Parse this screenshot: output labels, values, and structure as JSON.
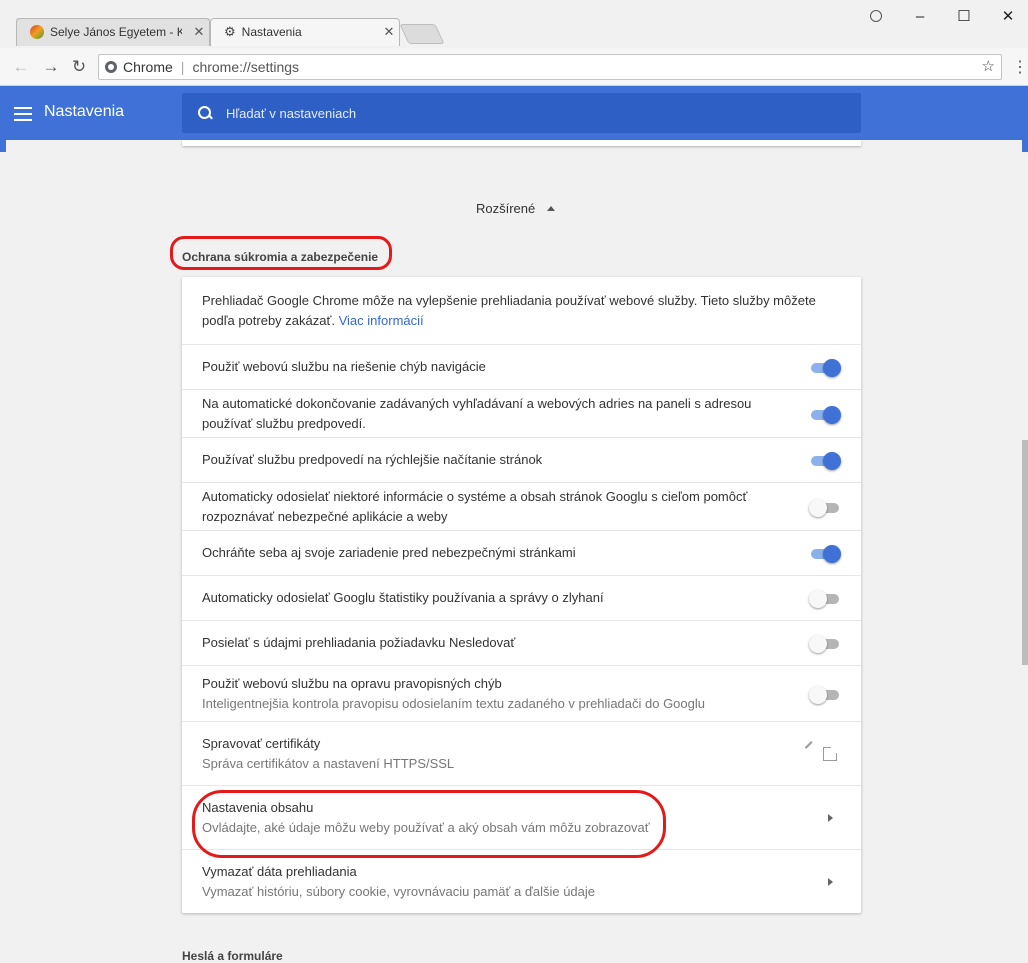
{
  "browser": {
    "tabs": [
      {
        "title": "Selye János Egyetem - Ke"
      },
      {
        "title": "Nastavenia"
      }
    ],
    "omnibox": {
      "scheme_label": "Chrome",
      "url": "chrome://settings"
    }
  },
  "header": {
    "title": "Nastavenia",
    "search_placeholder": "Hľadať v nastaveniach"
  },
  "advanced_label": "Rozšírené",
  "privacy_section": {
    "heading": "Ochrana súkromia a zabezpečenie",
    "intro": {
      "text": "Prehliadač Google Chrome môže na vylepšenie prehliadania používať webové služby. Tieto služby môžete podľa potreby zakázať.",
      "link": "Viac informácií"
    },
    "toggles": [
      {
        "label": "Použiť webovú službu na riešenie chýb navigácie",
        "sub": "",
        "on": true
      },
      {
        "label": "Na automatické dokončovanie zadávaných vyhľadávaní a webových adries na paneli s adresou používať službu predpovedí.",
        "sub": "",
        "on": true
      },
      {
        "label": "Používať službu predpovedí na rýchlejšie načítanie stránok",
        "sub": "",
        "on": true
      },
      {
        "label": "Automaticky odosielať niektoré informácie o systéme a obsah stránok Googlu s cieľom pomôcť rozpoznávať nebezpečné aplikácie a weby",
        "sub": "",
        "on": false
      },
      {
        "label": "Ochráňte seba aj svoje zariadenie pred nebezpečnými stránkami",
        "sub": "",
        "on": true
      },
      {
        "label": "Automaticky odosielať Googlu štatistiky používania a správy o zlyhaní",
        "sub": "",
        "on": false
      },
      {
        "label": "Posielať s údajmi prehliadania požiadavku Nesledovať",
        "sub": "",
        "on": false
      },
      {
        "label": "Použiť webovú službu na opravu pravopisných chýb",
        "sub": "Inteligentnejšia kontrola pravopisu odosielaním textu zadaného v prehliadači do Googlu",
        "on": false
      }
    ],
    "certificates": {
      "label": "Spravovať certifikáty",
      "sub": "Správa certifikátov a nastavení HTTPS/SSL"
    },
    "content_settings": {
      "label": "Nastavenia obsahu",
      "sub": "Ovládajte, aké údaje môžu weby používať a aký obsah vám môžu zobrazovať"
    },
    "clear_data": {
      "label": "Vymazať dáta prehliadania",
      "sub": "Vymazať históriu, súbory cookie, vyrovnávaciu pamäť a ďalšie údaje"
    }
  },
  "passwords_section": {
    "heading": "Heslá a formuláre"
  }
}
